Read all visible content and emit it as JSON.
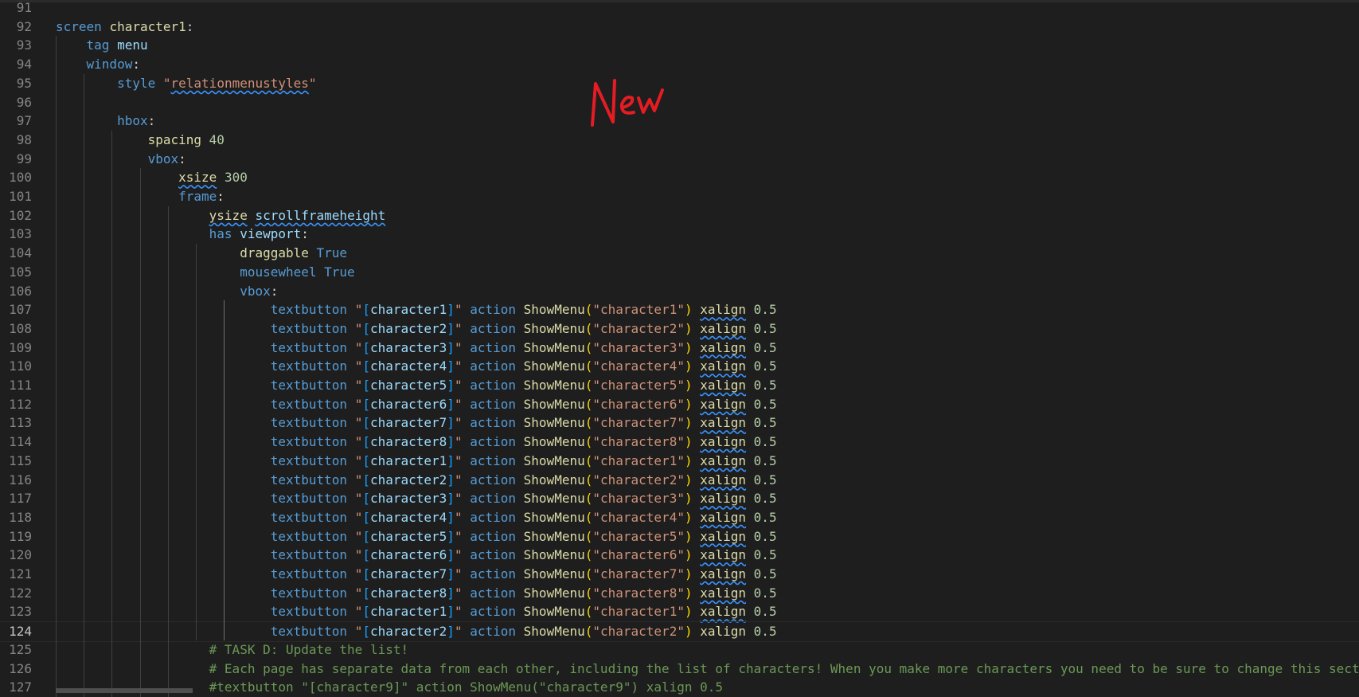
{
  "editor": {
    "active_line": "124",
    "annotation_text": "New",
    "annotation_color": "#e51c23",
    "lines": [
      {
        "n": "91",
        "tokens": []
      },
      {
        "n": "92",
        "tokens": [
          {
            "t": "screen",
            "c": "kw"
          },
          {
            "t": " ",
            "c": "wht"
          },
          {
            "t": "character1",
            "c": "yel"
          },
          {
            "t": ":",
            "c": "wht"
          }
        ]
      },
      {
        "n": "93",
        "tokens": [
          {
            "t": "    ",
            "c": "wht"
          },
          {
            "t": "tag",
            "c": "kw"
          },
          {
            "t": " ",
            "c": "wht"
          },
          {
            "t": "menu",
            "c": "lt"
          }
        ]
      },
      {
        "n": "94",
        "tokens": [
          {
            "t": "    ",
            "c": "wht"
          },
          {
            "t": "window",
            "c": "kw"
          },
          {
            "t": ":",
            "c": "wht"
          }
        ]
      },
      {
        "n": "95",
        "tokens": [
          {
            "t": "        ",
            "c": "wht"
          },
          {
            "t": "style",
            "c": "kw"
          },
          {
            "t": " ",
            "c": "wht"
          },
          {
            "t": "\"",
            "c": "str"
          },
          {
            "t": "relationmenustyles",
            "c": "str squig"
          },
          {
            "t": "\"",
            "c": "str"
          }
        ]
      },
      {
        "n": "96",
        "tokens": []
      },
      {
        "n": "97",
        "tokens": [
          {
            "t": "        ",
            "c": "wht"
          },
          {
            "t": "hbox",
            "c": "kw"
          },
          {
            "t": ":",
            "c": "wht"
          }
        ]
      },
      {
        "n": "98",
        "tokens": [
          {
            "t": "            ",
            "c": "wht"
          },
          {
            "t": "spacing",
            "c": "yel"
          },
          {
            "t": " ",
            "c": "wht"
          },
          {
            "t": "40",
            "c": "num"
          }
        ]
      },
      {
        "n": "99",
        "tokens": [
          {
            "t": "            ",
            "c": "wht"
          },
          {
            "t": "vbox",
            "c": "kw"
          },
          {
            "t": ":",
            "c": "wht"
          }
        ]
      },
      {
        "n": "100",
        "tokens": [
          {
            "t": "                ",
            "c": "wht"
          },
          {
            "t": "xsize",
            "c": "yel squig"
          },
          {
            "t": " ",
            "c": "wht"
          },
          {
            "t": "300",
            "c": "num"
          }
        ]
      },
      {
        "n": "101",
        "tokens": [
          {
            "t": "                ",
            "c": "wht"
          },
          {
            "t": "frame",
            "c": "kw"
          },
          {
            "t": ":",
            "c": "wht"
          }
        ]
      },
      {
        "n": "102",
        "tokens": [
          {
            "t": "                    ",
            "c": "wht"
          },
          {
            "t": "ysize",
            "c": "yel squig"
          },
          {
            "t": " ",
            "c": "wht"
          },
          {
            "t": "scrollframeheight",
            "c": "prop squig"
          }
        ]
      },
      {
        "n": "103",
        "tokens": [
          {
            "t": "                    ",
            "c": "wht"
          },
          {
            "t": "has",
            "c": "kw"
          },
          {
            "t": " ",
            "c": "wht"
          },
          {
            "t": "viewport",
            "c": "prop"
          },
          {
            "t": ":",
            "c": "wht"
          }
        ]
      },
      {
        "n": "104",
        "tokens": [
          {
            "t": "                        ",
            "c": "wht"
          },
          {
            "t": "draggable",
            "c": "yel"
          },
          {
            "t": " ",
            "c": "wht"
          },
          {
            "t": "True",
            "c": "kw"
          }
        ]
      },
      {
        "n": "105",
        "tokens": [
          {
            "t": "                        ",
            "c": "wht"
          },
          {
            "t": "mousewheel",
            "c": "kw"
          },
          {
            "t": " ",
            "c": "wht"
          },
          {
            "t": "True",
            "c": "kw"
          }
        ]
      },
      {
        "n": "106",
        "tokens": [
          {
            "t": "                        ",
            "c": "wht"
          },
          {
            "t": "vbox",
            "c": "kw"
          },
          {
            "t": ":",
            "c": "wht"
          }
        ]
      },
      {
        "n": "107",
        "tb": "1"
      },
      {
        "n": "108",
        "tb": "2"
      },
      {
        "n": "109",
        "tb": "3"
      },
      {
        "n": "110",
        "tb": "4"
      },
      {
        "n": "111",
        "tb": "5"
      },
      {
        "n": "112",
        "tb": "6"
      },
      {
        "n": "113",
        "tb": "7"
      },
      {
        "n": "114",
        "tb": "8"
      },
      {
        "n": "115",
        "tb": "1"
      },
      {
        "n": "116",
        "tb": "2"
      },
      {
        "n": "117",
        "tb": "3"
      },
      {
        "n": "118",
        "tb": "4"
      },
      {
        "n": "119",
        "tb": "5"
      },
      {
        "n": "120",
        "tb": "6"
      },
      {
        "n": "121",
        "tb": "7"
      },
      {
        "n": "122",
        "tb": "8"
      },
      {
        "n": "123",
        "tb": "1"
      },
      {
        "n": "124",
        "tb": "2",
        "nosquig": true
      },
      {
        "n": "125",
        "tokens": [
          {
            "t": "                    ",
            "c": "wht"
          },
          {
            "t": "# TASK D: Update the list!",
            "c": "cmt"
          }
        ]
      },
      {
        "n": "126",
        "tokens": [
          {
            "t": "                    ",
            "c": "wht"
          },
          {
            "t": "# Each page has separate data from each other, including the list of characters! When you make more characters you need to be sure to change this sect",
            "c": "cmt"
          }
        ]
      },
      {
        "n": "127",
        "tokens": [
          {
            "t": "                    ",
            "c": "wht"
          },
          {
            "t": "#textbutton \"[character9]\" action ShowMenu(\"character9\") xalign 0.5",
            "c": "cmt"
          }
        ]
      }
    ],
    "textbutton_template": {
      "kw": "textbutton",
      "action": "action",
      "func": "ShowMenu",
      "prop": "xalign",
      "val": "0.5",
      "name_prefix": "character"
    }
  }
}
